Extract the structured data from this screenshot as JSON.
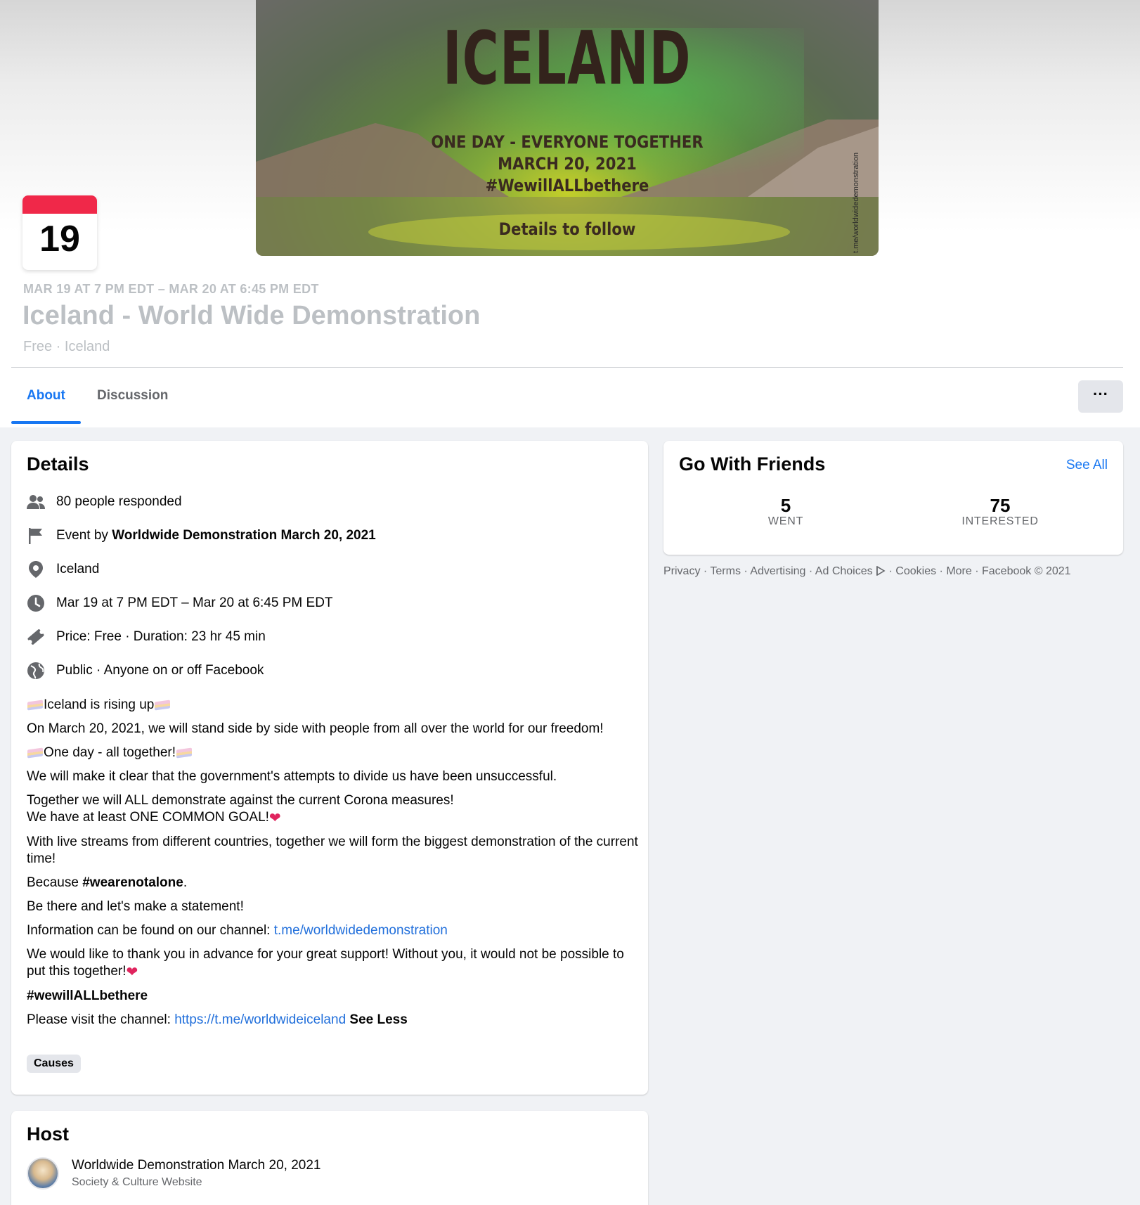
{
  "cover": {
    "title": "ICELAND",
    "line1": "ONE DAY - EVERYONE TOGETHER",
    "line2": "MARCH 20, 2021",
    "line3": "#WewillALLbethere",
    "line4": "Details to follow",
    "vertical": "t.me/worldwidedemonstration"
  },
  "calendar": {
    "day": "19"
  },
  "event": {
    "date_line": "MAR 19 AT 7 PM EDT – MAR 20 AT 6:45 PM EDT",
    "title": "Iceland - World Wide Demonstration",
    "subline": "Free · Iceland"
  },
  "tabs": [
    {
      "label": "About"
    },
    {
      "label": "Discussion"
    }
  ],
  "more_button": "···",
  "details": {
    "heading": "Details",
    "responded": "80 people responded",
    "event_by_prefix": "Event by ",
    "event_by_name": "Worldwide Demonstration March 20, 2021",
    "location": "Iceland",
    "time": "Mar 19 at 7 PM EDT – Mar 20 at 6:45 PM EDT",
    "price": "Price: Free · Duration: 23 hr 45 min",
    "privacy": "Public · Anyone on or off Facebook",
    "desc": {
      "p1": "Iceland is rising up",
      "p2": "On March 20, 2021, we will stand side by side with people from all over the world for our freedom!",
      "p3": "One day - all together!",
      "p4": "We will make it clear that the government's attempts to divide us have been unsuccessful.",
      "p5a": "Together we will ALL demonstrate against the current Corona measures!",
      "p5b": "We have at least ONE COMMON GOAL!",
      "p6": "With live streams from different countries, together we will form the biggest demonstration of the current time!",
      "p7a": "Because ",
      "p7b": "#wearenotalone",
      "p7c": ".",
      "p8": "Be there and let's make a statement!",
      "p9a": "Information can be found on our channel: ",
      "p9b": "t.me/worldwidedemonstration",
      "p10": "We would like to thank you in advance for your great support! Without you, it would not be possible to put this together!",
      "p11": "#wewillALLbethere",
      "p12a": "Please visit the channel: ",
      "p12b": "https://t.me/worldwideiceland",
      "p12c": "See Less"
    },
    "tag": "Causes"
  },
  "friends": {
    "heading": "Go With Friends",
    "see_all": "See All",
    "went_num": "5",
    "went_label": "WENT",
    "interested_num": "75",
    "interested_label": "INTERESTED"
  },
  "footer": {
    "privacy": "Privacy",
    "terms": "Terms",
    "advertising": "Advertising",
    "ad_choices": "Ad Choices",
    "cookies": "Cookies",
    "more": "More",
    "copyright": "Facebook © 2021",
    "sep": " · "
  },
  "host": {
    "heading": "Host",
    "name": "Worldwide Demonstration March 20, 2021",
    "category": "Society & Culture Website"
  },
  "colors": {
    "accent": "#1877f2",
    "calendar_red": "#f02849",
    "heart": "#e0245e"
  }
}
